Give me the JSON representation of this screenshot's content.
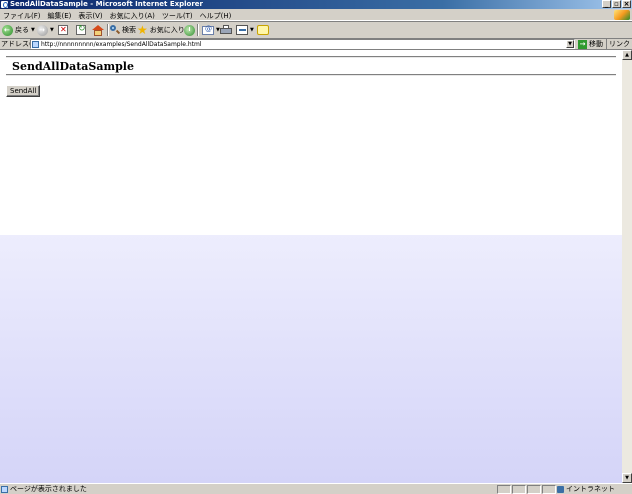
{
  "window": {
    "title": "SendAllDataSample - Microsoft Internet Explorer"
  },
  "menu": [
    "ファイル(F)",
    "編集(E)",
    "表示(V)",
    "お気に入り(A)",
    "ツール(T)",
    "ヘルプ(H)"
  ],
  "toolbar": {
    "back_label": "戻る",
    "search_label": "検索",
    "favorites_label": "お気に入り"
  },
  "address": {
    "label": "アドレス(D)",
    "url": "http://nnnnnnnnn/examples/SendAllDataSample.html",
    "go_label": "移動",
    "links_label": "リンク"
  },
  "page": {
    "heading": "SendAllDataSample",
    "button_label": "SendAll"
  },
  "status": {
    "text": "ページが表示されました",
    "zone": "イントラネット"
  }
}
